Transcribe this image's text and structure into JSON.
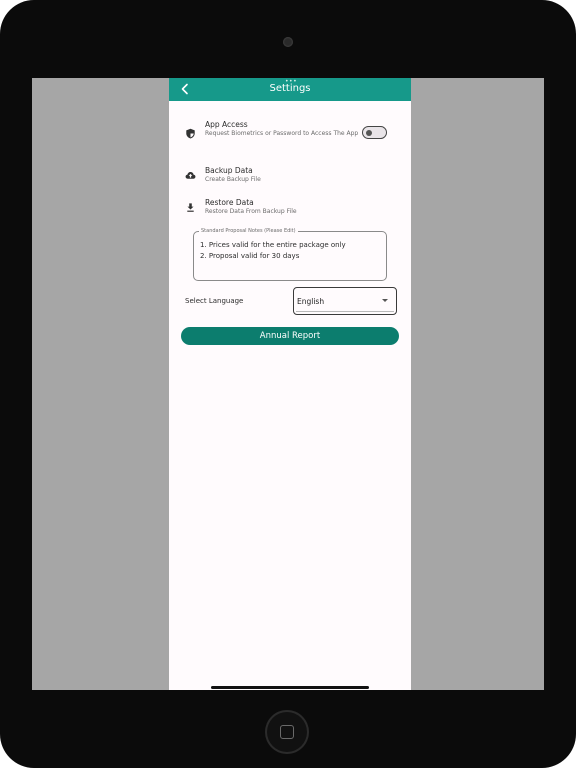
{
  "appbar": {
    "title": "Settings",
    "back_icon": "chevron-left-icon",
    "color": "#16998a"
  },
  "settings": {
    "app_access": {
      "icon": "shield-icon",
      "label": "App Access",
      "subtitle": "Request Biometrics or Password to Access The App",
      "toggle_on": false
    },
    "backup": {
      "icon": "cloud-upload-icon",
      "label": "Backup Data",
      "subtitle": "Create Backup File"
    },
    "restore": {
      "icon": "download-icon",
      "label": "Restore Data",
      "subtitle": "Restore Data From Backup File"
    }
  },
  "notes": {
    "legend": "Standard Proposal Notes (Please Edit)",
    "lines": [
      "1. Prices valid for the entire package only",
      "2. Proposal valid for 30 days"
    ]
  },
  "language": {
    "label": "Select Language",
    "selected": "English"
  },
  "annual_report": {
    "label": "Annual Report",
    "color": "#0c7d6e"
  }
}
